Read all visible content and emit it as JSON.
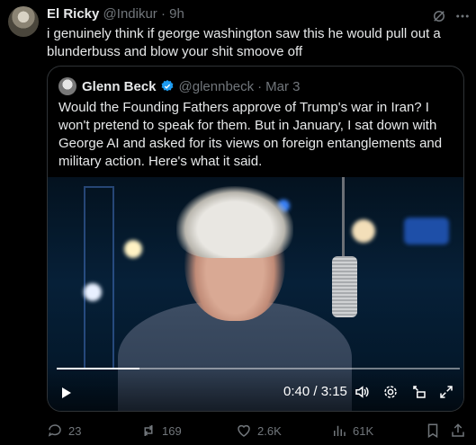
{
  "tweet": {
    "author_name": "El Ricky",
    "handle": "@Indikur",
    "separator": "·",
    "time": "9h",
    "text": "i genuinely think if george washington saw this he would pull out a blunderbuss and blow your shit smoove off"
  },
  "quote": {
    "author_name": "Glenn Beck",
    "handle": "@glennbeck",
    "separator": "·",
    "date": "Mar 3",
    "text": "Would the Founding Fathers approve of Trump's war in Iran? I won't pretend to speak for them. But in January, I sat down with George AI and asked for its views on foreign entanglements and military action. Here's what it said.",
    "video": {
      "time_display": "0:40 / 3:15",
      "progress_fraction": 0.205
    }
  },
  "actions": {
    "replies": "23",
    "reposts": "169",
    "likes": "2.6K",
    "views": "61K"
  },
  "colors": {
    "verified": "#1d9bf0",
    "muted": "#71767b",
    "text": "#e7e9ea"
  }
}
